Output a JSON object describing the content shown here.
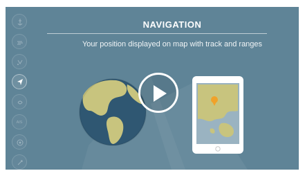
{
  "video": {
    "title": "NAVIGATION",
    "subtitle": "Your position displayed on map with track and ranges"
  },
  "sidebar": {
    "items": [
      {
        "name": "anchor-icon"
      },
      {
        "name": "wind-icon"
      },
      {
        "name": "depth-icon"
      },
      {
        "name": "navigation-arrow-icon",
        "active": true
      },
      {
        "name": "sound-icon"
      },
      {
        "label": "AIS"
      },
      {
        "name": "radar-icon"
      },
      {
        "name": "settings-icon"
      }
    ]
  },
  "colors": {
    "background": "#5f8497",
    "ocean": "#2f5772",
    "land": "#c8c47e",
    "tablet_screen": "#9ab3c1",
    "position_marker": "#f0a22a"
  }
}
